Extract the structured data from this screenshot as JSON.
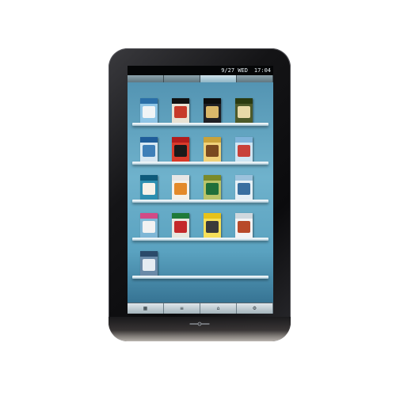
{
  "status_bar": {
    "date": "9/27 WED",
    "time": "17:04"
  },
  "tabs": [
    {
      "label": ""
    },
    {
      "label": ""
    },
    {
      "label": ""
    },
    {
      "label": ""
    }
  ],
  "shelves": [
    {
      "books": [
        {
          "stripe": "#2a6fa8",
          "cover": "#8ec5e6",
          "art": "#f0f4f6"
        },
        {
          "stripe": "#111111",
          "cover": "#e8e2d4",
          "art": "#c73a2a"
        },
        {
          "stripe": "#0d0d0d",
          "cover": "#1f1f24",
          "art": "#d9b76a"
        },
        {
          "stripe": "#2a3a10",
          "cover": "#4d5a2a",
          "art": "#e8d9a8"
        }
      ]
    },
    {
      "books": [
        {
          "stripe": "#1f5d9a",
          "cover": "#d7e7f2",
          "art": "#3f7fb8"
        },
        {
          "stripe": "#b31c1c",
          "cover": "#d93b2b",
          "art": "#1a1a1a"
        },
        {
          "stripe": "#c9a23a",
          "cover": "#f0d27a",
          "art": "#7a4a1f"
        },
        {
          "stripe": "#7fb3d9",
          "cover": "#cfe6f4",
          "art": "#c8413a"
        }
      ]
    },
    {
      "books": [
        {
          "stripe": "#0e5a7a",
          "cover": "#2d8fb0",
          "art": "#f6f2e8"
        },
        {
          "stripe": "#e6e6e6",
          "cover": "#f4f1ea",
          "art": "#e38a2a"
        },
        {
          "stripe": "#7a8a2a",
          "cover": "#b9c46a",
          "art": "#1f6f3a"
        },
        {
          "stripe": "#9cc2dc",
          "cover": "#e6f0f6",
          "art": "#3a6fa0"
        }
      ]
    },
    {
      "books": [
        {
          "stripe": "#d24a86",
          "cover": "#7fb7d6",
          "art": "#f2f2f2"
        },
        {
          "stripe": "#1f7a3a",
          "cover": "#e8e8e0",
          "art": "#c4282a"
        },
        {
          "stripe": "#e6c21a",
          "cover": "#f6e05a",
          "art": "#3a3a3a"
        },
        {
          "stripe": "#cfd8de",
          "cover": "#f2f4f6",
          "art": "#b84a2a"
        }
      ]
    },
    {
      "books": [
        {
          "stripe": "#2a4a6a",
          "cover": "#6a8aa8",
          "art": "#e6ecf2"
        }
      ]
    }
  ],
  "bottom_nav": [
    {
      "label": "",
      "icon": "grid-icon",
      "glyph": "▦"
    },
    {
      "label": "",
      "icon": "list-icon",
      "glyph": "≡"
    },
    {
      "label": "",
      "icon": "cart-icon",
      "glyph": "⌂"
    },
    {
      "label": "",
      "icon": "settings-icon",
      "glyph": "⚙"
    }
  ]
}
